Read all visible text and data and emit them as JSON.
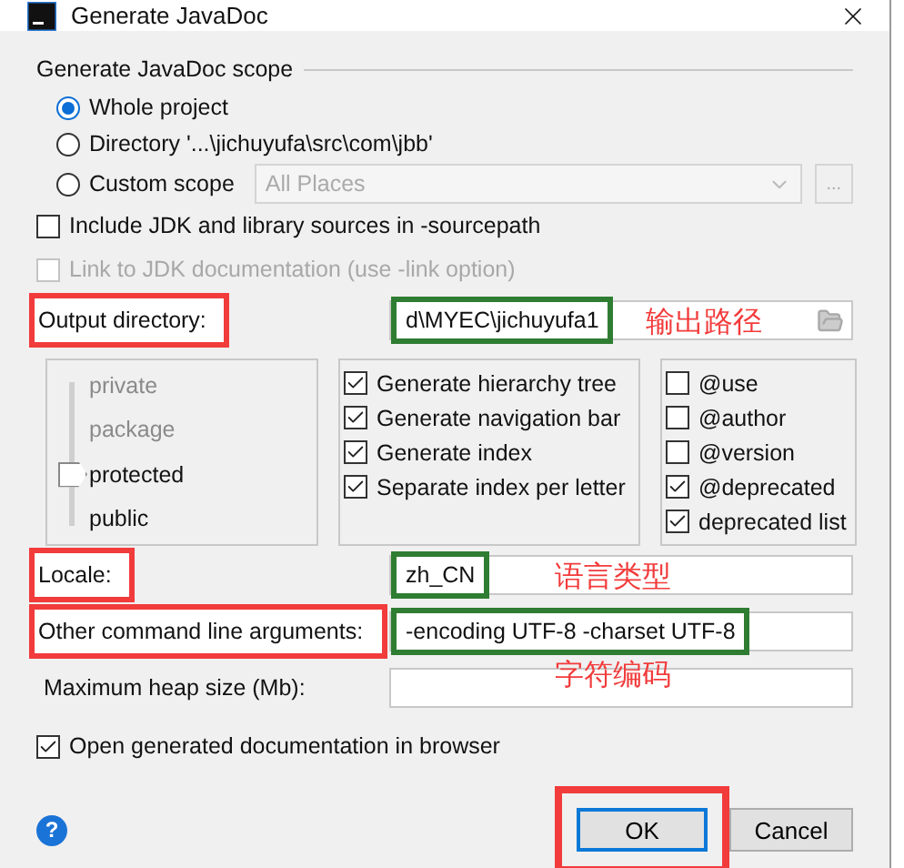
{
  "window": {
    "title": "Generate JavaDoc"
  },
  "scope": {
    "heading": "Generate JavaDoc scope",
    "options": [
      {
        "label": "Whole project",
        "selected": true
      },
      {
        "label": "Directory '...\\jichuyufa\\src\\com\\jbb'",
        "selected": false
      },
      {
        "label": "Custom scope",
        "selected": false,
        "combo": "All Places",
        "browse": "..."
      }
    ]
  },
  "include_jdk": {
    "label": "Include JDK and library sources in -sourcepath",
    "checked": false
  },
  "link_jdk": {
    "label": "Link to JDK documentation (use -link option)",
    "checked": false,
    "disabled": true
  },
  "output": {
    "label": "Output directory:",
    "value": "d\\MYEC\\jichuyufa1",
    "note": "输出路径",
    "highlighted": true
  },
  "visibility": [
    {
      "label": "private",
      "selected": false
    },
    {
      "label": "package",
      "selected": false
    },
    {
      "label": "protected",
      "selected": true
    },
    {
      "label": "public",
      "selected": false
    }
  ],
  "options": [
    {
      "label": "Generate hierarchy tree",
      "checked": true
    },
    {
      "label": "Generate navigation bar",
      "checked": true
    },
    {
      "label": "Generate index",
      "checked": true
    },
    {
      "label": "Separate index per letter",
      "checked": true
    }
  ],
  "tags": [
    {
      "label": "@use",
      "checked": false
    },
    {
      "label": "@author",
      "checked": false
    },
    {
      "label": "@version",
      "checked": false
    },
    {
      "label": "@deprecated",
      "checked": true
    },
    {
      "label": "deprecated list",
      "checked": true
    }
  ],
  "locale": {
    "label": "Locale:",
    "value": "zh_CN",
    "note": "语言类型",
    "highlighted": true
  },
  "arguments": {
    "label": "Other command line arguments:",
    "value": "-encoding UTF-8 -charset UTF-8",
    "note": "字符编码",
    "highlighted": true
  },
  "heap": {
    "label": "Maximum heap size (Mb):",
    "highlighted": false
  },
  "open_browser": {
    "label": "Open generated documentation in browser",
    "checked": true
  },
  "help": "?",
  "buttons": [
    {
      "label": "OK",
      "default": true,
      "highlighted": true
    },
    {
      "label": "Cancel",
      "default": false,
      "highlighted": false
    }
  ]
}
